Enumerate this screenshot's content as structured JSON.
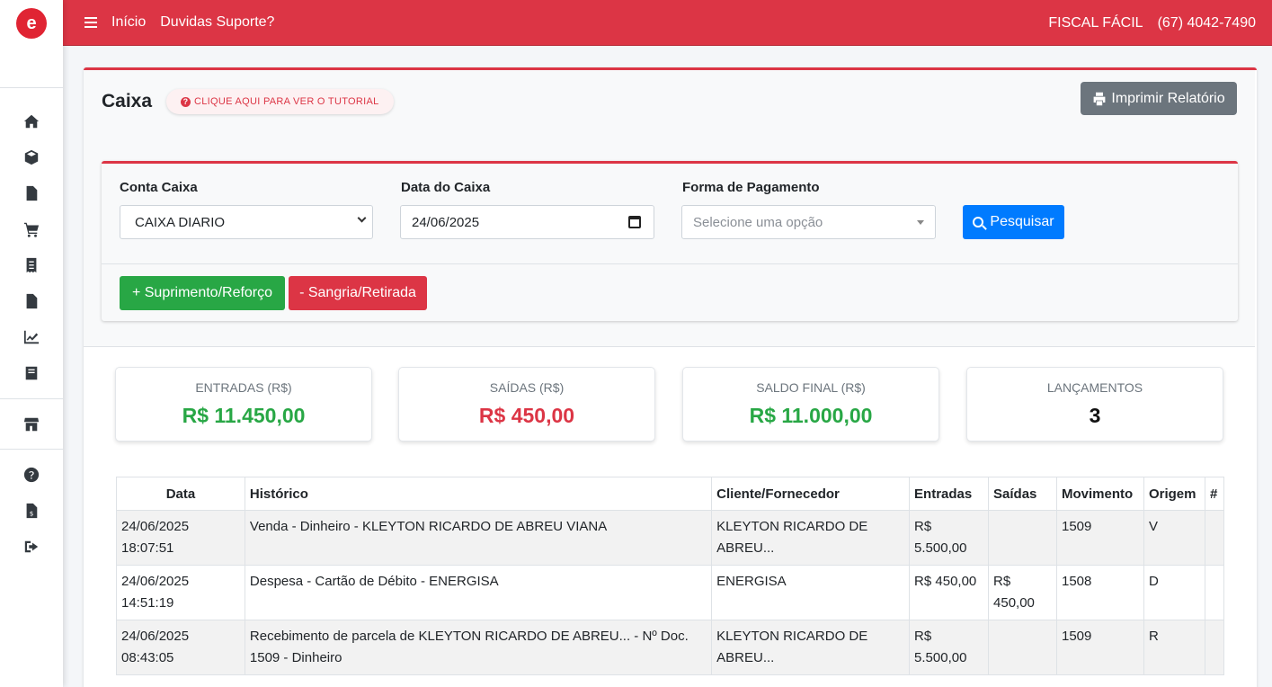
{
  "nav": {
    "links": [
      "Início",
      "Duvidas Suporte?"
    ],
    "brand": "FISCAL FÁCIL",
    "phone": "(67) 4042-7490"
  },
  "sidebar": {
    "icons": [
      "home-icon",
      "box-icon",
      "file-icon",
      "cart-icon",
      "receipt-icon",
      "document-icon",
      "chart-line-icon",
      "book-icon",
      "store-icon",
      "question-icon",
      "invoice-icon",
      "sign-out-icon"
    ]
  },
  "page": {
    "title": "Caixa",
    "tutorial_label": "CLIQUE AQUI PARA VER O TUTORIAL",
    "print_label": "Imprimir Relatório"
  },
  "filter": {
    "conta_label": "Conta Caixa",
    "conta_value": "CAIXA DIARIO",
    "data_label": "Data do Caixa",
    "data_value": "24/06/2025",
    "forma_label": "Forma de Pagamento",
    "forma_placeholder": "Selecione uma opção",
    "search_label": "Pesquisar",
    "suprimento_label": "+ Suprimento/Reforço",
    "sangria_label": "- Sangria/Retirada"
  },
  "stats": {
    "entradas_label": "ENTRADAS (R$)",
    "entradas_value": "R$ 11.450,00",
    "saidas_label": "SAÍDAS (R$)",
    "saidas_value": "R$ 450,00",
    "saldo_label": "SALDO FINAL (R$)",
    "saldo_value": "R$ 11.000,00",
    "lancamentos_label": "LANÇAMENTOS",
    "lancamentos_value": "3"
  },
  "table": {
    "headers": [
      "Data",
      "Histórico",
      "Cliente/Fornecedor",
      "Entradas",
      "Saídas",
      "Movimento",
      "Origem",
      "#"
    ],
    "rows": [
      {
        "data": "24/06/2025",
        "hora": "18:07:51",
        "historico": "Venda - Dinheiro - KLEYTON RICARDO DE ABREU VIANA",
        "historico2": "",
        "cliente": "KLEYTON RICARDO DE",
        "cliente2": "ABREU...",
        "entradas": "R$",
        "entradas2": "5.500,00",
        "saidas": "",
        "saidas2": "",
        "movimento": "1509",
        "origem": "V"
      },
      {
        "data": "24/06/2025",
        "hora": "14:51:19",
        "historico": "Despesa - Cartão de Débito - ENERGISA",
        "historico2": "",
        "cliente": "ENERGISA",
        "cliente2": "",
        "entradas": "R$ 450,00",
        "entradas2": "",
        "saidas": "R$",
        "saidas2": "450,00",
        "movimento": "1508",
        "origem": "D"
      },
      {
        "data": "24/06/2025",
        "hora": "08:43:05",
        "historico": "Recebimento de parcela de KLEYTON RICARDO DE ABREU... - Nº Doc.",
        "historico2": "1509 - Dinheiro",
        "cliente": "KLEYTON RICARDO DE",
        "cliente2": "ABREU...",
        "entradas": "R$",
        "entradas2": "5.500,00",
        "saidas": "",
        "saidas2": "",
        "movimento": "1509",
        "origem": "R"
      }
    ]
  }
}
